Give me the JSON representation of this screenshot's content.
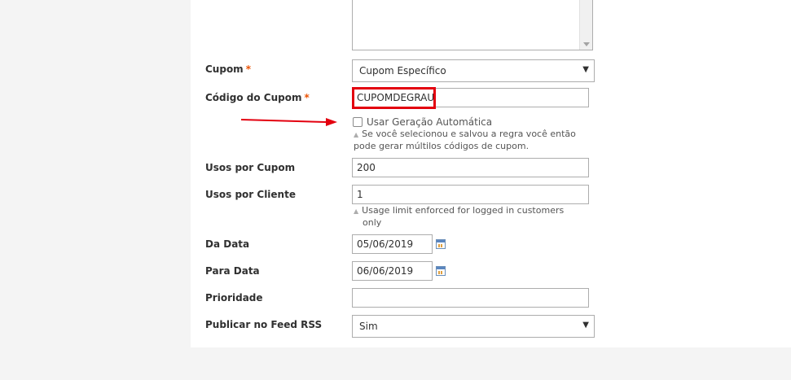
{
  "form": {
    "coupon": {
      "label": "Cupom",
      "required_mark": "*",
      "selected": "Cupom Específico"
    },
    "coupon_code": {
      "label": "Código do Cupom",
      "required_mark": "*",
      "value": "CUPOMDEGRAU"
    },
    "auto_generation": {
      "label": "Usar Geração Automática",
      "checked": false,
      "note_line1": "Se você selecionou e salvou a regra você então",
      "note_line2": "pode gerar múltilos códigos de cupom."
    },
    "uses_per_coupon": {
      "label": "Usos por Cupom",
      "value": "200"
    },
    "uses_per_customer": {
      "label": "Usos por Cliente",
      "value": "1",
      "note_line1": "Usage limit enforced for logged in customers",
      "note_line2": "only"
    },
    "from_date": {
      "label": "Da Data",
      "value": "05/06/2019"
    },
    "to_date": {
      "label": "Para Data",
      "value": "06/06/2019"
    },
    "priority": {
      "label": "Prioridade",
      "value": ""
    },
    "rss": {
      "label": "Publicar no Feed RSS",
      "selected": "Sim"
    }
  },
  "colors": {
    "annotation_red": "#e3000f",
    "required": "#eb5202"
  },
  "icons": {
    "calendar": "calendar-icon",
    "dropdown": "chevron-down-icon"
  }
}
